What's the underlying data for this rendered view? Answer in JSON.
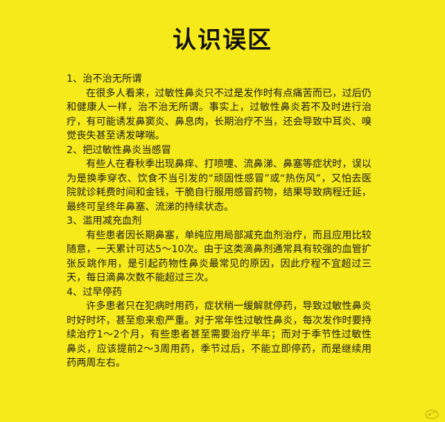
{
  "title": "认识误区",
  "sections": [
    {
      "heading": "1、治不治无所谓",
      "body": "在很多人看来，过敏性鼻炎只不过是发作时有点痛苦而已，过后仍和健康人一样，治不治无所谓。事实上，过敏性鼻炎若不及时进行治疗，有可能诱发鼻窦炎、鼻息肉，长期治疗不当，还会导致中耳炎、嗅觉丧失甚至诱发哮喘。"
    },
    {
      "heading": "2、把过敏性鼻炎当感冒",
      "body": "有些人在春秋季出现鼻痒、打喷嚏、流鼻涕、鼻塞等症状时，误以为是换季穿衣、饮食不当引发的“顽固性感冒”或“热伤风”，又怕去医院就诊耗费时间和金钱，干脆自行服用感冒药物，结果导致病程迁延，最终可呈终年鼻塞、流涕的持续状态。"
    },
    {
      "heading": "3、滥用减充血剂",
      "body": "有些患者因长期鼻塞，单纯应用局部减充血剂治疗，而且应用比较随意，一天累计可达5～10次。由于这类滴鼻剂通常具有较强的血管扩张反跳作用，是引起药物性鼻炎最常见的原因，因此疗程不宜超过三天，每日滴鼻次数不能超过三次。"
    },
    {
      "heading": "4、过早停药",
      "body": "许多患者只在犯病时用药，症状稍一缓解就停药，导致过敏性鼻炎时好时坏，甚至愈来愈严重。对于常年性过敏性鼻炎，每次发作时要持续治疗1～2个月，有些患者甚至需要治疗半年；而对于季节性过敏性鼻炎，应该提前2～3周用药，季节过后，不能立即停药，而是继续用药两周左右。"
    }
  ]
}
